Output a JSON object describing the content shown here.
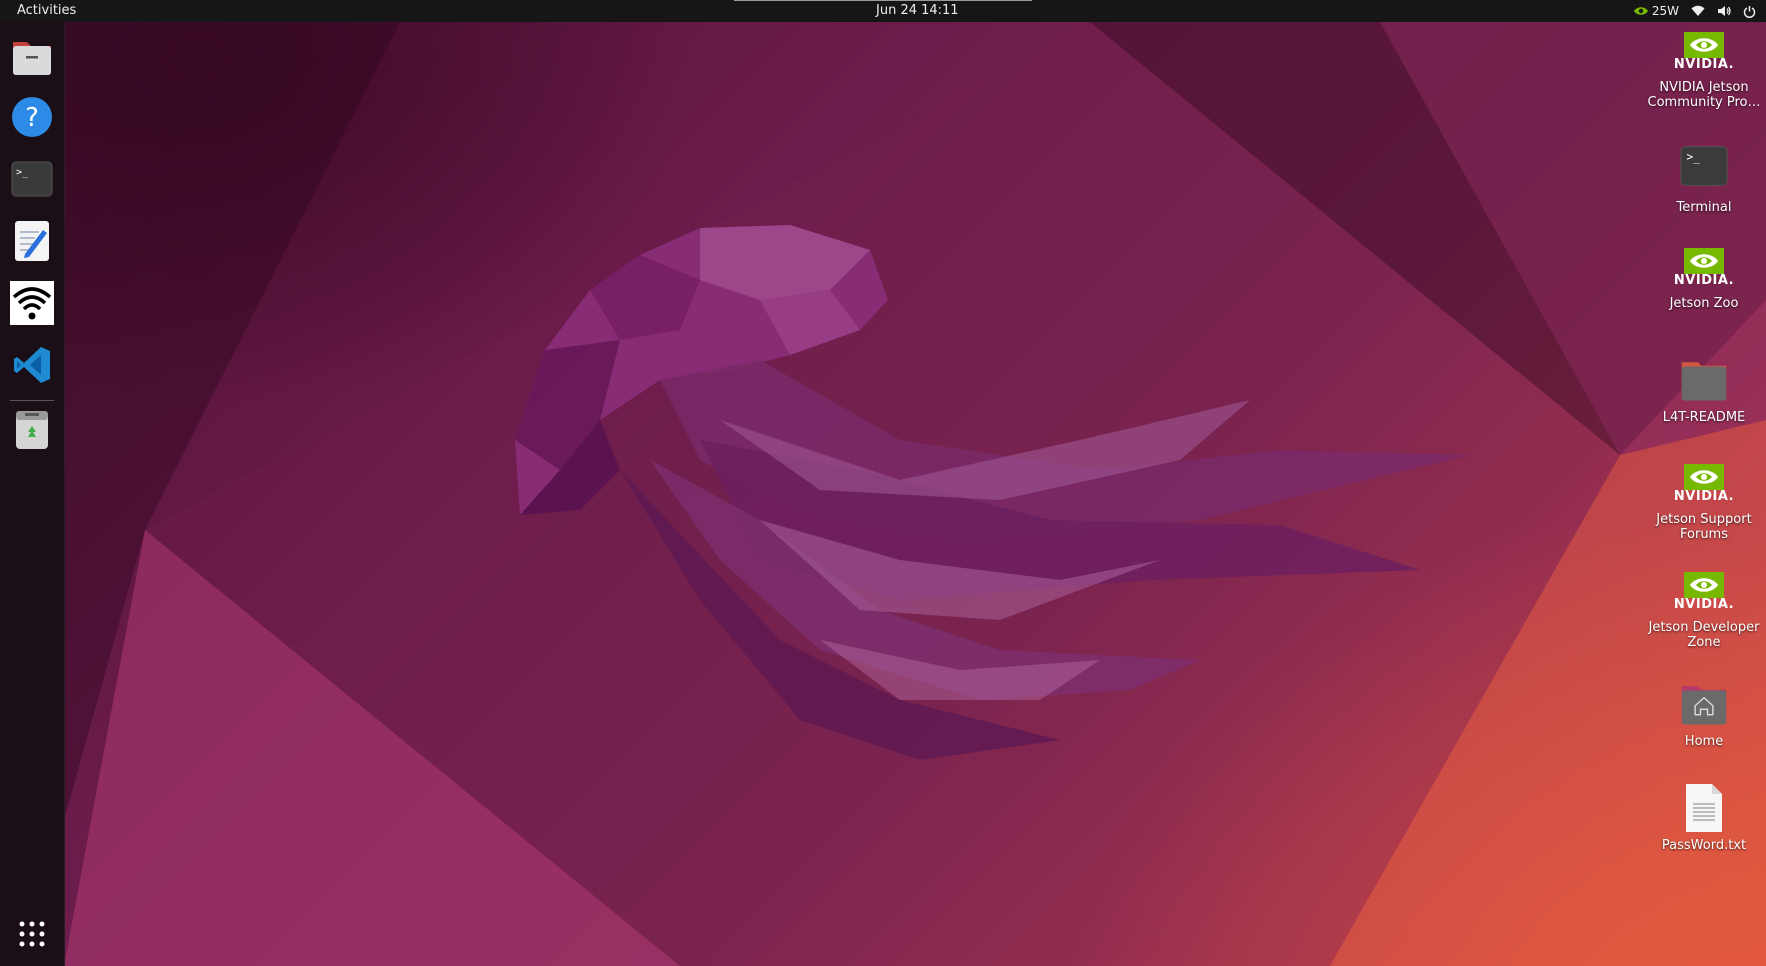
{
  "topbar": {
    "activities": "Activities",
    "clock": "Jun 24  14:11",
    "power_mode": "25W"
  },
  "dock": {
    "items": [
      {
        "name": "Files",
        "icon": "files-icon"
      },
      {
        "name": "Help",
        "icon": "help-icon"
      },
      {
        "name": "Terminal",
        "icon": "terminal-icon"
      },
      {
        "name": "Text Editor",
        "icon": "text-editor-icon"
      },
      {
        "name": "Wi-Fi",
        "icon": "wifi-icon"
      },
      {
        "name": "Visual Studio Code",
        "icon": "vscode-icon"
      },
      {
        "name": "Trash",
        "icon": "trash-icon"
      },
      {
        "name": "Show Applications",
        "icon": "app-grid-icon"
      }
    ]
  },
  "desktop": {
    "icons": [
      {
        "label": "NVIDIA Jetson Community Pro…",
        "icon": "nvidia-logo-icon",
        "nvidia_word": "NVIDIA."
      },
      {
        "label": "Terminal",
        "icon": "terminal-icon"
      },
      {
        "label": "Jetson Zoo",
        "icon": "nvidia-logo-icon",
        "nvidia_word": "NVIDIA."
      },
      {
        "label": "L4T-README",
        "icon": "folder-icon"
      },
      {
        "label": "Jetson Support Forums",
        "icon": "nvidia-logo-icon",
        "nvidia_word": "NVIDIA."
      },
      {
        "label": "Jetson Developer Zone",
        "icon": "nvidia-logo-icon",
        "nvidia_word": "NVIDIA."
      },
      {
        "label": "Home",
        "icon": "home-folder-icon"
      },
      {
        "label": "PassWord.txt",
        "icon": "text-file-icon"
      }
    ]
  },
  "colors": {
    "topbar": "#161616",
    "dock": "#1a0f16",
    "nvidia_green": "#76b900",
    "folder": "#5f5f5f",
    "wallpaper_dark": "#4a0f30",
    "wallpaper_orange": "#d9503f"
  }
}
